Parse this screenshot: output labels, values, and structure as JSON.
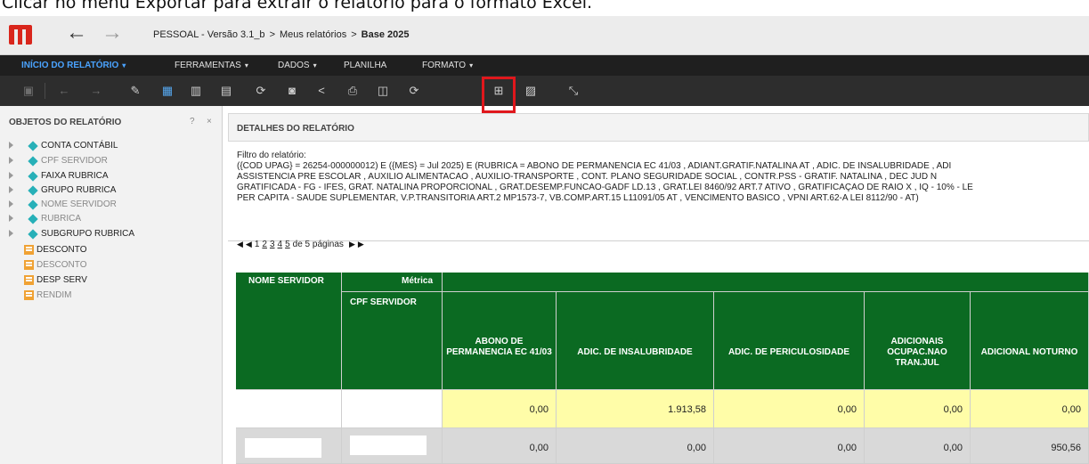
{
  "caption": "Clicar no menu Exportar para extrair o relatório para o formato Excel.",
  "titlebar": {
    "back_icon": "arrow-left-icon",
    "forward_icon": "arrow-right-icon",
    "crumb_app": "PESSOAL - Versão 3.1_b",
    "crumb_sep": ">",
    "crumb_folder": "Meus relatórios",
    "crumb_current": "Base 2025"
  },
  "menubar": {
    "items": [
      "INÍCIO DO RELATÓRIO",
      "FERRAMENTAS",
      "DADOS",
      "PLANILHA",
      "FORMATO"
    ],
    "caret": "▾",
    "active_color": "#4aa3ff"
  },
  "toolbar": {
    "icons": [
      "save-icon",
      "undo-icon",
      "redo-icon",
      "edit-icon",
      "grid-icon",
      "bar-chart-icon",
      "grid-graph-icon",
      "refresh-icon",
      "save-as-icon",
      "share-icon",
      "print-icon",
      "schedule-icon",
      "subscribe-icon",
      "export-icon",
      "present-icon",
      "fullscreen-icon"
    ],
    "highlight_color": "#e0171c"
  },
  "sidebar": {
    "title": "OBJETOS DO RELATÓRIO",
    "help": "?",
    "close": "×",
    "attributes": [
      {
        "label": "CONTA CONTÁBIL",
        "active": true
      },
      {
        "label": "CPF SERVIDOR",
        "active": false
      },
      {
        "label": "FAIXA RUBRICA",
        "active": true
      },
      {
        "label": "GRUPO RUBRICA",
        "active": true
      },
      {
        "label": "NOME SERVIDOR",
        "active": false
      },
      {
        "label": "RUBRICA",
        "active": false
      },
      {
        "label": "SUBGRUPO RUBRICA",
        "active": true
      }
    ],
    "metrics": [
      {
        "label": "DESCONTO",
        "active": true
      },
      {
        "label": "DESCONTO",
        "active": false
      },
      {
        "label": "DESP SERV",
        "active": true
      },
      {
        "label": "RENDIM",
        "active": false
      }
    ]
  },
  "details": {
    "title": "DETALHES DO RELATÓRIO",
    "filter_label": "Filtro do relatório:",
    "filter_lines": [
      "({COD UPAG} = 26254-000000012) E ({MÊS} = Jul 2025) E (RUBRICA = ABONO DE PERMANENCIA EC 41/03 , ADIANT.GRATIF.NATALINA AT , ADIC. DE INSALUBRIDADE , ADI",
      "ASSISTENCIA PRE ESCOLAR , AUXILIO ALIMENTACAO , AUXILIO-TRANSPORTE , CONT. PLANO SEGURIDADE SOCIAL , CONTR.PSS - GRATIF. NATALINA , DEC JUD N",
      "GRATIFICADA - FG - IFES, GRAT. NATALINA PROPORCIONAL , GRAT.DESEMP.FUNCAO-GADF LD.13 , GRAT.LEI 8460/92 ART.7 ATIVO , GRATIFICAÇÃO DE RAIO X , IQ - 10% - LE",
      "PER CAPITA - SAUDE SUPLEMENTAR, V.P.TRANSITORIA ART.2 MP1573-7, VB.COMP.ART.15 L11091/05 AT , VENCIMENTO BASICO , VPNI ART.62-A LEI 8112/90 - AT)"
    ]
  },
  "pager": {
    "first": "◀",
    "prev": "◀",
    "pages": [
      "1",
      "2",
      "3",
      "4",
      "5"
    ],
    "summary": "de 5 páginas",
    "next": "▶",
    "last": "▶"
  },
  "grid": {
    "header_row": {
      "col1": "NOME SERVIDOR",
      "col2": "Métrica"
    },
    "sub_header": {
      "col2": "CPF SERVIDOR"
    },
    "metric_headers": [
      "ABONO DE PERMANENCIA EC 41/03",
      "ADIC. DE INSALUBRIDADE",
      "ADIC. DE PERICULOSIDADE",
      "ADICIONAIS OCUPAC.NAO TRAN.JUL",
      "ADICIONAL NOTURNO"
    ],
    "rows": [
      {
        "values": [
          "0,00",
          "1.913,58",
          "0,00",
          "0,00",
          "0,00"
        ]
      },
      {
        "values": [
          "0,00",
          "0,00",
          "0,00",
          "0,00",
          "950,56"
        ]
      }
    ],
    "header_color": "#0b6a22",
    "total_color": "#fffda8"
  }
}
